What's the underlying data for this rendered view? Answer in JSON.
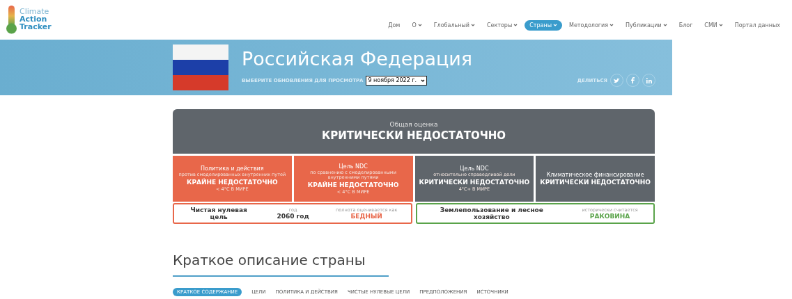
{
  "logo": {
    "lines": [
      "Climate",
      "Action",
      "Tracker"
    ]
  },
  "nav": [
    {
      "label": "Дом",
      "dropdown": false,
      "selected": false
    },
    {
      "label": "О",
      "dropdown": true,
      "selected": false
    },
    {
      "label": "Глобальный",
      "dropdown": true,
      "selected": false
    },
    {
      "label": "Секторы",
      "dropdown": true,
      "selected": false
    },
    {
      "label": "Страны",
      "dropdown": true,
      "selected": true
    },
    {
      "label": "Методология",
      "dropdown": true,
      "selected": false
    },
    {
      "label": "Публикации",
      "dropdown": true,
      "selected": false
    },
    {
      "label": "Блог",
      "dropdown": false,
      "selected": false
    },
    {
      "label": "СМИ",
      "dropdown": true,
      "selected": false
    },
    {
      "label": "Портал данных",
      "dropdown": false,
      "selected": false
    }
  ],
  "banner": {
    "title": "Российская Федерация",
    "update_label": "ВЫБЕРИТЕ ОБНОВЛЕНИЯ ДЛЯ ПРОСМОТРА",
    "update_value": "9 ноября 2022 г.",
    "share_label": "ДЕЛИТЬСЯ",
    "share": [
      {
        "kind": "twitter"
      },
      {
        "kind": "facebook"
      },
      {
        "kind": "linkedin"
      }
    ]
  },
  "overall": {
    "label": "Общая оценка",
    "rating": "КРИТИЧЕСКИ НЕДОСТАТОЧНО"
  },
  "ratings": [
    {
      "title": "Политика и действия",
      "subtitle": "против смоделированных внутренних путей",
      "rating": "КРАЙНЕ НЕДОСТАТОЧНО",
      "note": "< 4°C В МИРЕ",
      "color": "#e8674a"
    },
    {
      "title": "Цель NDC",
      "subtitle": "по сравнению с смоделированными внутренними путями",
      "rating": "КРАЙНЕ НЕДОСТАТОЧНО",
      "note": "< 4°C В МИРЕ",
      "color": "#e8674a"
    },
    {
      "title": "Цель NDC",
      "subtitle": "относительно справедливой доли",
      "rating": "КРИТИЧЕСКИ НЕДОСТАТОЧНО",
      "note": "4°C+ В МИРЕ",
      "color": "#5f656b"
    },
    {
      "title": "Климатическое финансирование",
      "rating": "КРИТИЧЕСКИ НЕДОСТАТОЧНО",
      "color": "#5f656b"
    }
  ],
  "net_zero": {
    "title": "Чистая нулевая цель",
    "year_label": "год",
    "year": "2060 год",
    "assessed_label": "полнота оценивается как",
    "assessment": "БЕДНЫЙ",
    "color": "#e8674a"
  },
  "land_use": {
    "title": "Землепользование и лесное хозяйство",
    "assessed_label": "исторически считается",
    "assessment": "РАКОВИНА",
    "color": "#5aa34a"
  },
  "section": {
    "heading": "Краткое описание страны"
  },
  "tabs": [
    {
      "label": "КРАТКОЕ СОДЕРЖАНИЕ",
      "selected": true
    },
    {
      "label": "ЦЕЛИ",
      "selected": false
    },
    {
      "label": "ПОЛИТИКА И ДЕЙСТВИЯ",
      "selected": false
    },
    {
      "label": "ЧИСТЫЕ НУЛЕВЫЕ ЦЕЛИ",
      "selected": false
    },
    {
      "label": "ПРЕДПОЛОЖЕНИЯ",
      "selected": false
    },
    {
      "label": "ИСТОЧНИКИ",
      "selected": false
    }
  ]
}
